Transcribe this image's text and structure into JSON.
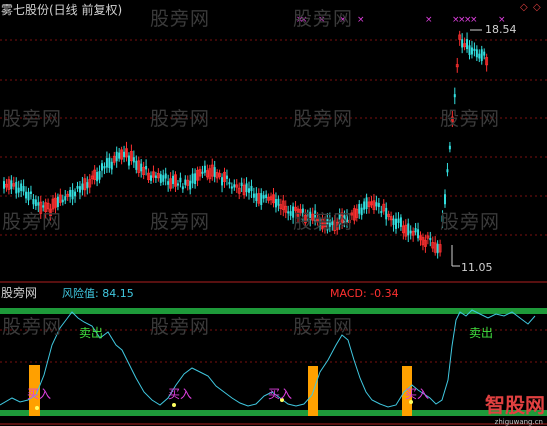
{
  "top_panel": {
    "title": "雾七股份(日线 前复权)",
    "high_label": "18.54",
    "low_label": "11.05"
  },
  "bottom_panel": {
    "source_label": "股旁网",
    "risk_label": "风险值: 84.15",
    "macd_label": "MACD: -0.34",
    "sell_labels": [
      "卖出",
      "卖出"
    ],
    "buy_labels": [
      "买入",
      "买入",
      "买入",
      "买入"
    ]
  },
  "watermarks": [
    "股旁网"
  ],
  "brand": {
    "name": "智股网",
    "url": "zhiguwang.cn"
  },
  "colors": {
    "background": "#000000",
    "up_candle": "#ff3030",
    "down_candle": "#33e0e0",
    "risk_line": "#40c8e0",
    "band": "#1e9a3a",
    "buy_bar": "#ffa000",
    "cross_marker": "#e040e0",
    "title_text": "#d0d0d0",
    "risk_text": "#40c8e0",
    "macd_text": "#ff3030"
  },
  "chart_data": {
    "type": "candlestick",
    "y_high": 18.54,
    "y_low": 11.05,
    "indicator": {
      "name": "风险值",
      "last_value": 84.15
    },
    "macd": {
      "last_value": -0.34
    }
  }
}
